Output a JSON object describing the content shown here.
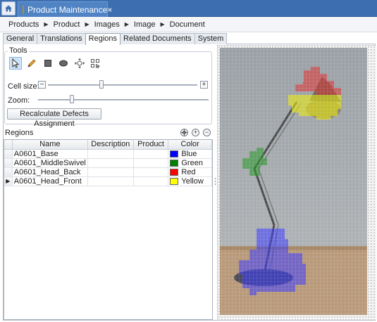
{
  "window": {
    "tab_title": "Product Maintenance",
    "close_glyph": "×"
  },
  "breadcrumb": {
    "items": [
      "Products",
      "Product",
      "Images",
      "Image",
      "Document"
    ],
    "separator": "▶"
  },
  "tabs": [
    {
      "label": "General",
      "active": false
    },
    {
      "label": "Translations",
      "active": false
    },
    {
      "label": "Regions",
      "active": true
    },
    {
      "label": "Related Documents",
      "active": false
    },
    {
      "label": "System",
      "active": false
    }
  ],
  "tools": {
    "legend": "Tools",
    "buttons": [
      "select-arrow-icon",
      "pencil-icon",
      "rectangle-icon",
      "ellipse-icon",
      "region-expand-icon",
      "grid-select-icon"
    ],
    "cell_size_label": "Cell size:",
    "zoom_label": "Zoom:",
    "cell_size_value": 0.36,
    "zoom_value": 0.2,
    "recalc_label": "Recalculate Defects Assignment"
  },
  "regions": {
    "label": "Regions",
    "columns": [
      "Name",
      "Description",
      "Product",
      "Color"
    ],
    "rows": [
      {
        "name": "A0601_Base",
        "description": "",
        "product": "",
        "color": "Blue",
        "hex": "#0000ff",
        "selected": false
      },
      {
        "name": "A0601_MiddleSwivel",
        "description": "",
        "product": "",
        "color": "Green",
        "hex": "#008000",
        "selected": false
      },
      {
        "name": "A0601_Head_Back",
        "description": "",
        "product": "",
        "color": "Red",
        "hex": "#ff0000",
        "selected": false
      },
      {
        "name": "A0601_Head_Front",
        "description": "",
        "product": "",
        "color": "Yellow",
        "hex": "#ffff00",
        "selected": true
      }
    ]
  },
  "colors": {
    "titlebar": "#3d6fb0",
    "active_tab": "#4f83c4",
    "region_blue": "#3a3aff",
    "region_green": "#2e9a2e",
    "region_red": "#e23030",
    "region_yellow": "#f0f000"
  }
}
